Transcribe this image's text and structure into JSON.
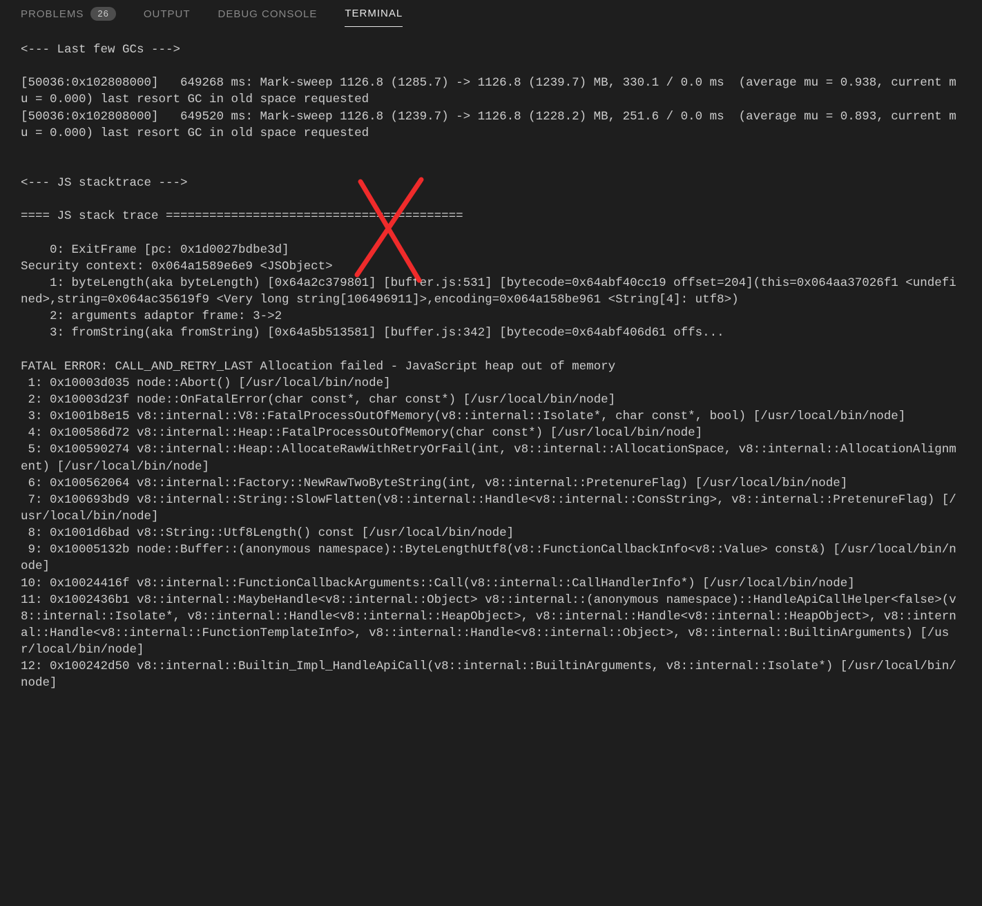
{
  "tabs": {
    "problems": {
      "label": "PROBLEMS",
      "badge": "26"
    },
    "output": {
      "label": "OUTPUT"
    },
    "debug": {
      "label": "DEBUG CONSOLE"
    },
    "terminal": {
      "label": "TERMINAL"
    }
  },
  "terminal_output": "<--- Last few GCs --->\n\n[50036:0x102808000]   649268 ms: Mark-sweep 1126.8 (1285.7) -> 1126.8 (1239.7) MB, 330.1 / 0.0 ms  (average mu = 0.938, current mu = 0.000) last resort GC in old space requested\n[50036:0x102808000]   649520 ms: Mark-sweep 1126.8 (1239.7) -> 1126.8 (1228.2) MB, 251.6 / 0.0 ms  (average mu = 0.893, current mu = 0.000) last resort GC in old space requested\n\n\n<--- JS stacktrace --->\n\n==== JS stack trace =========================================\n\n    0: ExitFrame [pc: 0x1d0027bdbe3d]\nSecurity context: 0x064a1589e6e9 <JSObject>\n    1: byteLength(aka byteLength) [0x64a2c379801] [buffer.js:531] [bytecode=0x64abf40cc19 offset=204](this=0x064aa37026f1 <undefined>,string=0x064ac35619f9 <Very long string[106496911]>,encoding=0x064a158be961 <String[4]: utf8>)\n    2: arguments adaptor frame: 3->2\n    3: fromString(aka fromString) [0x64a5b513581] [buffer.js:342] [bytecode=0x64abf406d61 offs...\n\nFATAL ERROR: CALL_AND_RETRY_LAST Allocation failed - JavaScript heap out of memory\n 1: 0x10003d035 node::Abort() [/usr/local/bin/node]\n 2: 0x10003d23f node::OnFatalError(char const*, char const*) [/usr/local/bin/node]\n 3: 0x1001b8e15 v8::internal::V8::FatalProcessOutOfMemory(v8::internal::Isolate*, char const*, bool) [/usr/local/bin/node]\n 4: 0x100586d72 v8::internal::Heap::FatalProcessOutOfMemory(char const*) [/usr/local/bin/node]\n 5: 0x100590274 v8::internal::Heap::AllocateRawWithRetryOrFail(int, v8::internal::AllocationSpace, v8::internal::AllocationAlignment) [/usr/local/bin/node]\n 6: 0x100562064 v8::internal::Factory::NewRawTwoByteString(int, v8::internal::PretenureFlag) [/usr/local/bin/node]\n 7: 0x100693bd9 v8::internal::String::SlowFlatten(v8::internal::Handle<v8::internal::ConsString>, v8::internal::PretenureFlag) [/usr/local/bin/node]\n 8: 0x1001d6bad v8::String::Utf8Length() const [/usr/local/bin/node]\n 9: 0x10005132b node::Buffer::(anonymous namespace)::ByteLengthUtf8(v8::FunctionCallbackInfo<v8::Value> const&) [/usr/local/bin/node]\n10: 0x10024416f v8::internal::FunctionCallbackArguments::Call(v8::internal::CallHandlerInfo*) [/usr/local/bin/node]\n11: 0x1002436b1 v8::internal::MaybeHandle<v8::internal::Object> v8::internal::(anonymous namespace)::HandleApiCallHelper<false>(v8::internal::Isolate*, v8::internal::Handle<v8::internal::HeapObject>, v8::internal::Handle<v8::internal::HeapObject>, v8::internal::Handle<v8::internal::FunctionTemplateInfo>, v8::internal::Handle<v8::internal::Object>, v8::internal::BuiltinArguments) [/usr/local/bin/node]\n12: 0x100242d50 v8::internal::Builtin_Impl_HandleApiCall(v8::internal::BuiltinArguments, v8::internal::Isolate*) [/usr/local/bin/node]"
}
